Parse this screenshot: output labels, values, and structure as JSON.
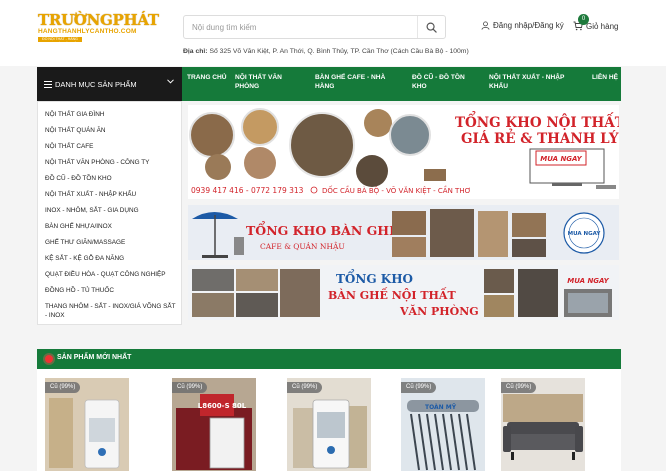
{
  "header": {
    "logo_main": "TRƯỜNGPHÁT",
    "logo_sub": "HANGTHANHLYCANTHO.COM",
    "logo_tag": "ĐỒ NỘI THẤT - HÀNG THANH LÝ - TÂN CŨ",
    "search_placeholder": "Nội dung tìm kiếm",
    "address_label": "Địa chỉ:",
    "address_value": "Số 325 Võ Văn Kiệt, P. An Thới, Q. Bình Thủy, TP. Cần Thơ (Cách Cầu Bà Bộ - 100m)",
    "login_label": "Đăng nhập/Đăng ký",
    "cart_label": "Giỏ hàng",
    "cart_count": "0"
  },
  "nav": {
    "category_label": "DANH MỤC SẢN PHẨM",
    "items": [
      "TRANG CHỦ",
      "NỘI THẤT VĂN PHÒNG",
      "BÀN GHẾ CAFE - NHÀ HÀNG",
      "ĐỒ CŨ - ĐỒ TỒN KHO",
      "NỘI THẤT XUẤT - NHẬP KHẨU",
      "LIÊN HỆ"
    ]
  },
  "sidebar": {
    "items": [
      "NỘI THẤT GIA ĐÌNH",
      "NỘI THẤT QUÁN ĂN",
      "NỘI THẤT CAFE",
      "NỘI THẤT VĂN PHÒNG - CÔNG TY",
      "ĐỒ CŨ - ĐỒ TỒN KHO",
      "NỘI THẤT XUẤT - NHẬP KHẨU",
      "INOX - NHÔM, SẮT - GIA DỤNG",
      "BÀN GHẾ NHỰA/INOX",
      "GHẾ THƯ GIÃN/MASSAGE",
      "KỆ SẮT - KỆ GỖ ĐA NĂNG",
      "QUẠT ĐIỀU HÒA - QUẠT CÔNG NGHIỆP",
      "ĐỒNG HỒ - TỦ THUỐC",
      "THANG NHÔM - SẮT - INOX/GIÁ VÕNG SẮT - INOX"
    ]
  },
  "banners": {
    "b1_title1": "TỔNG KHO NỘI THẤT",
    "b1_title2": "GIÁ RẺ & THANH LÝ",
    "b1_button": "MUA NGAY",
    "b1_phone": "0939 417 416 - 0772 179 313",
    "b1_address": "DỐC CẦU BÀ BỘ - VÕ VĂN KIỆT - CẦN THƠ",
    "b2_title": "TỔNG KHO BÀN GHẾ",
    "b2_sub": "CAFE & QUÁN NHẬU",
    "b2_badge": "MUA NGAY",
    "b3_title1": "TỔNG KHO",
    "b3_title2": "BÀN GHẾ NỘI THẤT",
    "b3_title3": "VĂN PHÒNG",
    "b3_button": "MUA NGAY"
  },
  "section": {
    "title": "SẢN PHẨM MỚI NHẤT"
  },
  "products": [
    {
      "badge": "Cũ (99%)",
      "label": ""
    },
    {
      "badge": "Cũ (99%)",
      "label": "L8600-S 80L"
    },
    {
      "badge": "Cũ (99%)",
      "label": ""
    },
    {
      "badge": "Cũ (99%)",
      "label": "TOÀN MỸ"
    },
    {
      "badge": "Cũ (99%)",
      "label": ""
    }
  ],
  "colors": {
    "brand_green": "#157a3a",
    "logo_gold": "#e8a400",
    "banner_red": "#d2232a",
    "category_bg": "#1a1a1a"
  }
}
